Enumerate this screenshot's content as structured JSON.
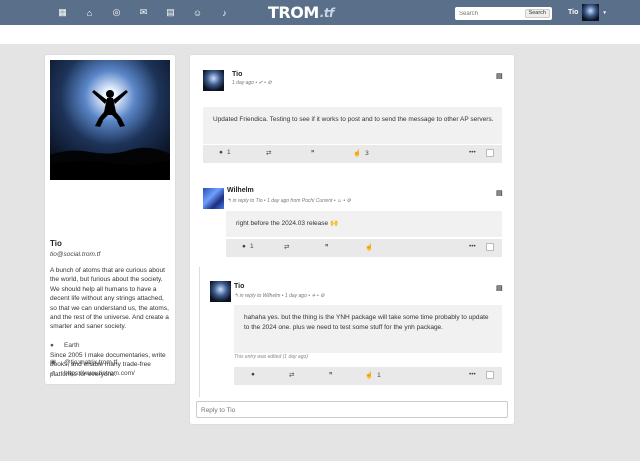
{
  "nav": {
    "items": [
      {
        "icon": "apps-grid-icon",
        "glyph": "▦"
      },
      {
        "icon": "home-icon",
        "glyph": "⌂"
      },
      {
        "icon": "network-icon",
        "glyph": "◎"
      },
      {
        "icon": "messages-icon",
        "glyph": "✉"
      },
      {
        "icon": "calendar-icon",
        "glyph": "▤"
      },
      {
        "icon": "contacts-icon",
        "glyph": "☺"
      },
      {
        "icon": "notifications-icon",
        "glyph": "♪"
      }
    ],
    "logo_main": "TROM",
    "logo_suffix": ".tf",
    "search_placeholder": "Search",
    "search_button": "Search",
    "user_name": "Tio",
    "caret": "▾",
    "bar_color": "#5a6f8a"
  },
  "profile": {
    "name": "Tio",
    "address": "tio@social.trom.tf",
    "about": "A bunch of atoms that are curious about the world, but furious about the society. We should help all humans to have a decent life without any strings attached, so that we can understand us, the atoms, and the rest of the universe. And create a smarter and saner society.",
    "about2": "Since 2005 I make documentaries, write books, and enable many trade-free platforms for everyone.",
    "location_icon": "●",
    "location": "Earth",
    "matrix_icon": "▣",
    "matrix": "@tio:matrix.trom.tf",
    "website_icon": "⇗",
    "website": "https://www.tiotrom.com/"
  },
  "posts": [
    {
      "author": "Tio",
      "meta": "1 day ago • ✔ • ⚙",
      "text": "Updated Friendica. Testing to see if it works to post and to send the message to other AP servers.",
      "comment_count": "1",
      "like_count": "3",
      "menu": "▤"
    },
    {
      "author": "Wilhelm",
      "meta": "↰ in reply to Tio • 1 day ago from Pochi Current • ☺ • ⚙",
      "text": "right before the 2024.03 release 🙌",
      "comment_count": "1",
      "menu": "▤"
    },
    {
      "author": "Tio",
      "meta": "↰ in reply to Wilhelm • 1 day ago • ✈ • ⚙",
      "text": "hahaha yes. but the thing is the YNH package will take some time probably to update to the 2024 one. plus we need to test some stuff for the ynh package.",
      "edited": "This entry was edited (1 day ago)",
      "like_count": "1",
      "menu": "▤"
    }
  ],
  "actions": {
    "comment_glyph": "●",
    "share_glyph": "⇄",
    "quote_glyph": "❞",
    "like_glyph": "☝",
    "more_glyph": "•••"
  },
  "reply_placeholder": "Reply to Tio"
}
